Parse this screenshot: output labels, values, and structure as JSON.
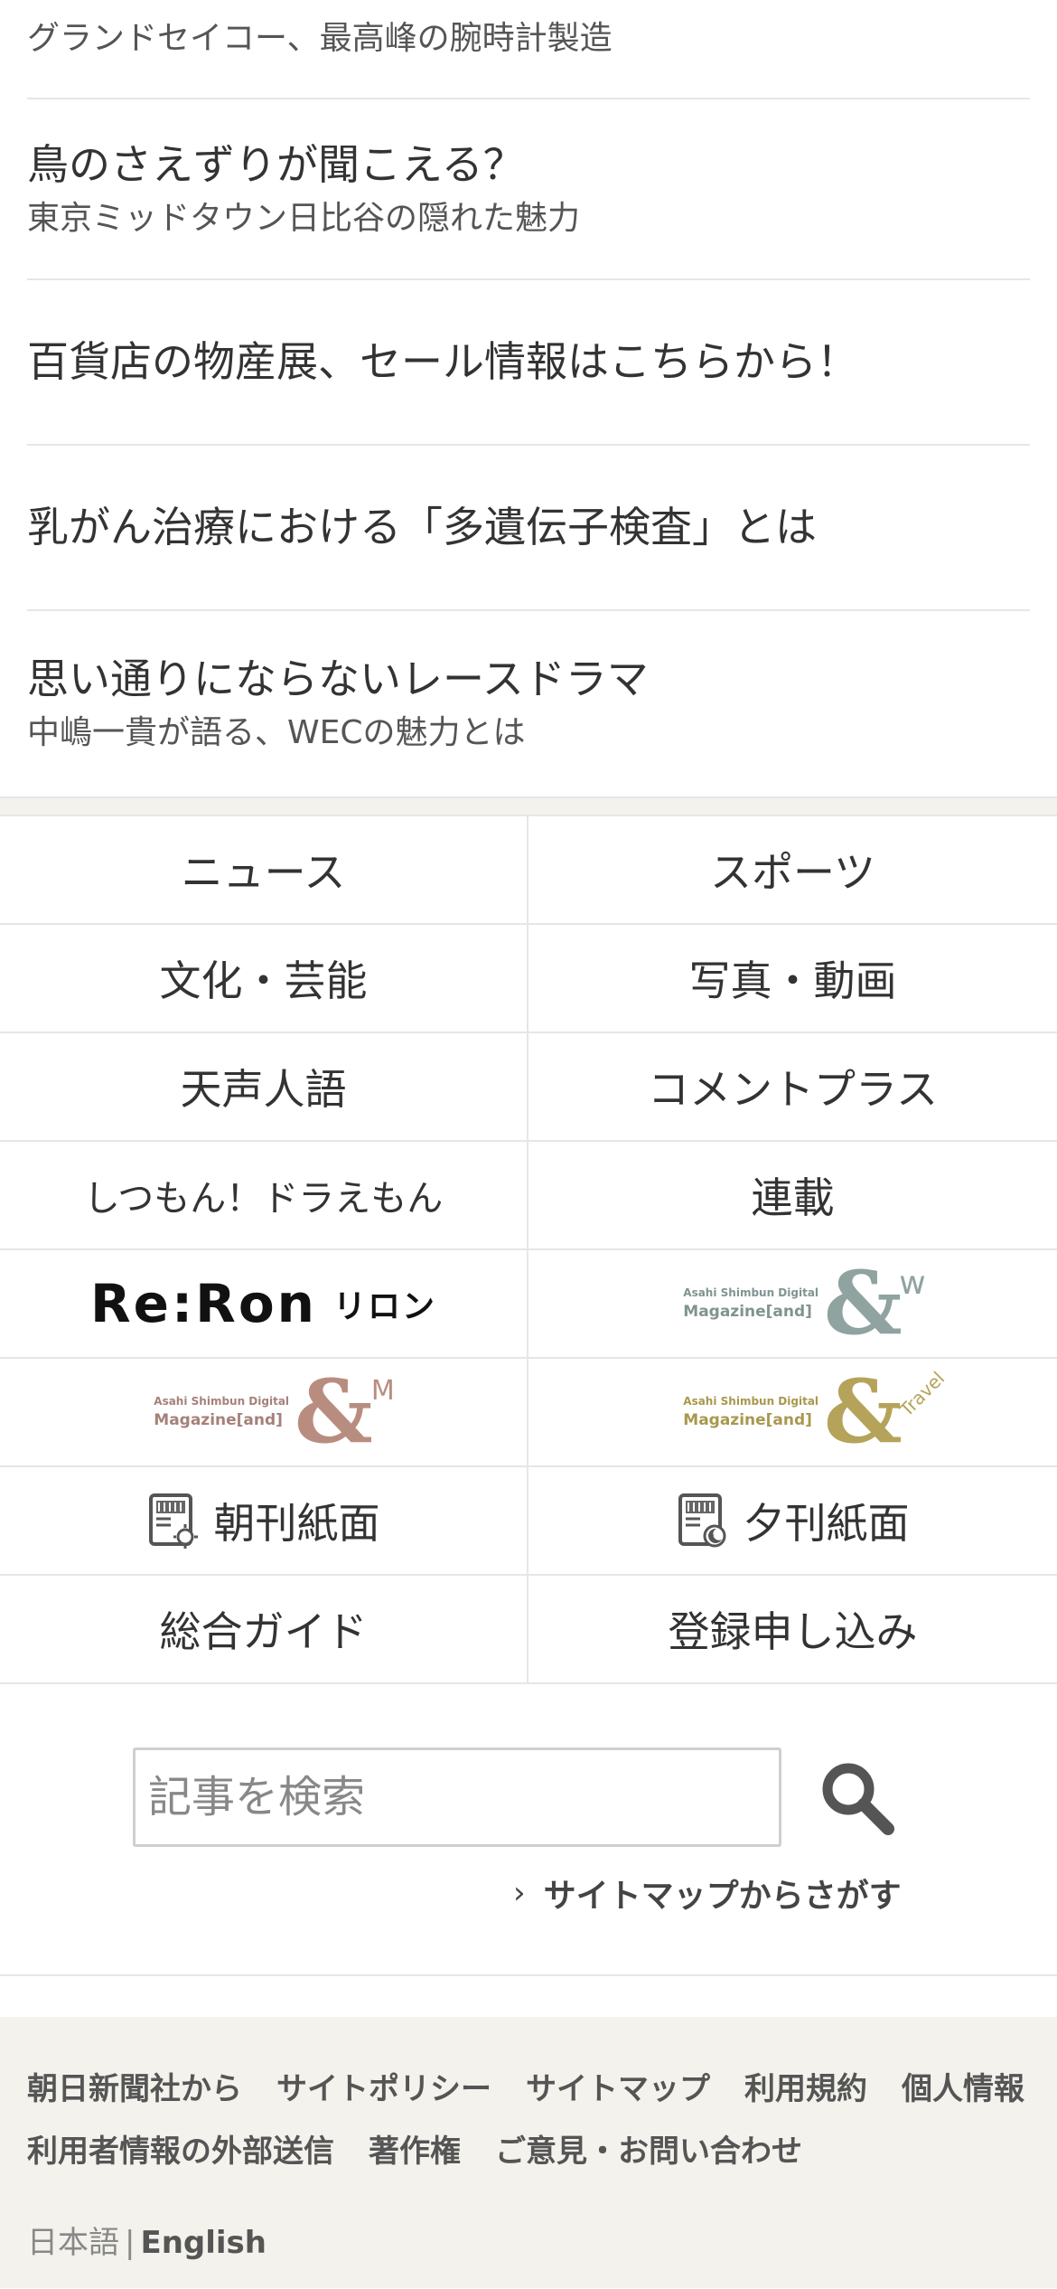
{
  "promos": [
    {
      "title": "",
      "sub": "グランドセイコー、最高峰の腕時計製造"
    },
    {
      "title": "鳥のさえずりが聞こえる？",
      "sub": "東京ミッドタウン日比谷の隠れた魅力"
    },
    {
      "title": "百貨店の物産展、セール情報はこちらから！",
      "sub": ""
    },
    {
      "title": "乳がん治療における「多遺伝子検査」とは",
      "sub": ""
    },
    {
      "title": "思い通りにならないレースドラマ",
      "sub": "中嶋一貴が語る、WECの魅力とは"
    }
  ],
  "nav": {
    "news": "ニュース",
    "sports": "スポーツ",
    "culture": "文化・芸能",
    "photo_video": "写真・動画",
    "tenseijingo": "天声人語",
    "comment_plus": "コメントプラス",
    "doraemon": "しつもん！ドラえもん",
    "serial": "連載",
    "reron_logo": "Re:Ron",
    "reron_kana": "リロン",
    "mag_w": {
      "small": "Asahi Shimbun Digital",
      "big": "Magazine[and]",
      "amp": "&",
      "suffix": "w",
      "color": "#8fa3a0"
    },
    "mag_m": {
      "small": "Asahi Shimbun Digital",
      "big": "Magazine[and]",
      "amp": "&",
      "suffix": "M",
      "color": "#b88d80"
    },
    "mag_travel": {
      "small": "Asahi Shimbun Digital",
      "big": "Magazine[and]",
      "amp": "&",
      "suffix": "Travel",
      "color": "#b5a35a"
    },
    "morning_paper": "朝刊紙面",
    "evening_paper": "夕刊紙面",
    "guide": "総合ガイド",
    "register": "登録申し込み"
  },
  "search": {
    "placeholder": "記事を検索",
    "icon": "search-icon",
    "sitemap_link": "サイトマップからさがす"
  },
  "footer": {
    "links": [
      "朝日新聞社から",
      "サイトポリシー",
      "サイトマップ",
      "利用規約",
      "個人情報",
      "利用者情報の外部送信",
      "著作権",
      "ご意見・お問い合わせ"
    ],
    "lang_ja": "日本語",
    "lang_separator": "|",
    "lang_en": "English"
  },
  "colors": {
    "background_band": "#f3f2ec",
    "divider": "#e6e6e6",
    "text": "#333333"
  }
}
